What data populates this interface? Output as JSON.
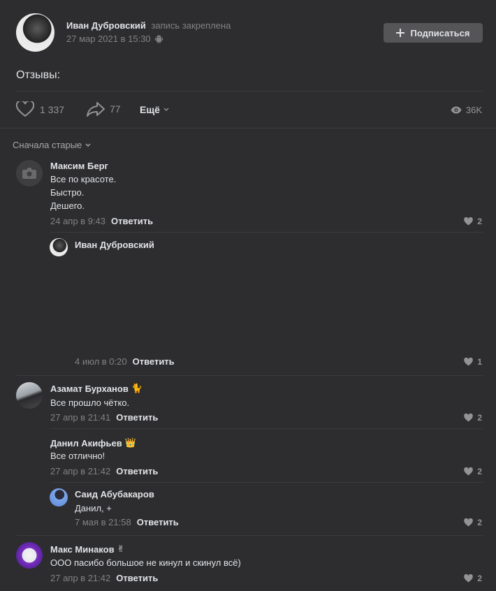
{
  "post": {
    "author": "Иван Дубровский",
    "pinned": "запись закреплена",
    "date": "27 мар 2021 в 15:30",
    "subscribe": "Подписаться",
    "text": "Отзывы:",
    "likes": "1 337",
    "shares": "77",
    "more": "Ещё",
    "views": "36K"
  },
  "comments": {
    "sort": "Сначала старые",
    "reply_label": "Ответить",
    "items": [
      {
        "name": "Максим Берг",
        "lines": [
          "Все по красоте.",
          "Быстро.",
          "Дешего."
        ],
        "date": "24 апр в 9:43",
        "likes": "2"
      },
      {
        "name": "Иван Дубровский",
        "date": "4 июл в 0:20",
        "likes": "1"
      },
      {
        "name": "Азамат Бурханов",
        "emoji": "🐈",
        "text": "Все прошло чётко.",
        "date": "27 апр в 21:41",
        "likes": "2"
      },
      {
        "name": "Данил Акифьев",
        "emoji": "👑",
        "text": "Все отлично!",
        "date": "27 апр в 21:42",
        "likes": "2"
      },
      {
        "name": "Саид Абубакаров",
        "text": "Данил, +",
        "date": "7 мая в 21:58",
        "likes": "2"
      },
      {
        "name": "Макс Минаков",
        "emoji": "✌",
        "text": "ООО пасибо большое не кинул и скинул всё)",
        "date": "27 апр в 21:42",
        "likes": "2"
      }
    ]
  },
  "colors": {
    "background": "#2d2d2f",
    "button": "#555558",
    "divider": "#3b3b3d",
    "muted": "#828282"
  }
}
